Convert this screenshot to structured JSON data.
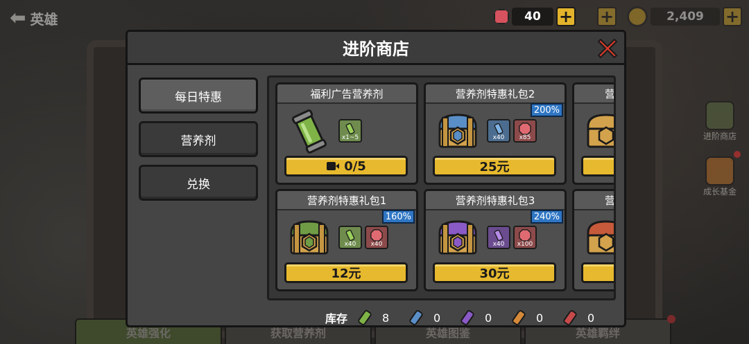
{
  "background": {
    "back_label": "英雄",
    "bottom_tabs": [
      "英雄强化",
      "获取营养剂",
      "英雄图鉴",
      "英雄羁绊"
    ],
    "side_buttons": [
      {
        "label": "进阶商店",
        "icon": "shop-icon"
      },
      {
        "label": "成长基金",
        "icon": "fund-icon"
      }
    ]
  },
  "currency": {
    "gems": "40",
    "coins": "2,409"
  },
  "modal": {
    "title": "进阶商店",
    "nav": [
      {
        "label": "每日特惠",
        "active": true
      },
      {
        "label": "营养剂",
        "active": false
      },
      {
        "label": "兑换",
        "active": false
      }
    ],
    "products": [
      {
        "title": "福利广告营养剂",
        "badge": "",
        "icon": "green-canister-icon",
        "items": [
          {
            "type": "green",
            "qty": "x1~5"
          }
        ],
        "price": "0/5",
        "price_icon": "video-icon"
      },
      {
        "title": "营养剂特惠礼包2",
        "badge": "200%",
        "icon": "blue-chest-icon",
        "items": [
          {
            "type": "blue",
            "qty": "x40"
          },
          {
            "type": "red",
            "qty": "x85"
          }
        ],
        "price": "25元"
      },
      {
        "title": "营",
        "badge": "",
        "icon": "chest-vi-icon",
        "items": [],
        "price": ""
      },
      {
        "title": "营养剂特惠礼包1",
        "badge": "160%",
        "icon": "green-chest-icon",
        "items": [
          {
            "type": "green",
            "qty": "x40"
          },
          {
            "type": "red",
            "qty": "x40"
          }
        ],
        "price": "12元"
      },
      {
        "title": "营养剂特惠礼包3",
        "badge": "240%",
        "icon": "purple-chest-icon",
        "items": [
          {
            "type": "purple",
            "qty": "x40"
          },
          {
            "type": "red",
            "qty": "x100"
          }
        ],
        "price": "30元"
      },
      {
        "title": "营",
        "badge": "",
        "icon": "chest-v-icon",
        "items": [],
        "price": ""
      }
    ],
    "stock": {
      "label": "库存",
      "items": [
        {
          "color": "green",
          "count": "8"
        },
        {
          "color": "blue",
          "count": "0"
        },
        {
          "color": "purple",
          "count": "0"
        },
        {
          "color": "orange",
          "count": "0"
        },
        {
          "color": "red",
          "count": "0"
        }
      ]
    }
  },
  "colors": {
    "accent_yellow": "#e7b92e",
    "close_red": "#d63a2a",
    "badge_blue": "#2f76c4",
    "green": "#7fb347",
    "blue": "#5a8ec7",
    "purple": "#8a5ac7",
    "orange": "#d48a3a",
    "red": "#c64a4a"
  }
}
